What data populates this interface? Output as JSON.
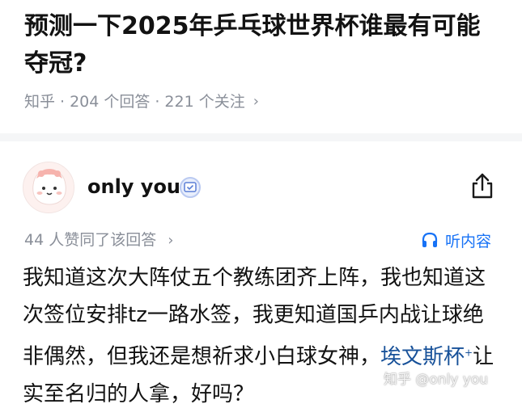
{
  "question": {
    "title": "预测一下2025年乒乓球世界杯谁最有可能夺冠?",
    "source": "知乎",
    "answers_count": "204 个回答",
    "follow_count": "221 个关注",
    "separator": "·",
    "chevron": "›"
  },
  "author": {
    "name": "only you",
    "verified_icon": "verified-badge-icon",
    "share_icon": "share-icon"
  },
  "answer": {
    "vote_text": "44 人赞同了该回答",
    "vote_chevron": "›",
    "listen_label": "听内容",
    "listen_icon": "headphones-icon",
    "body_before_link": "我知道这次大阵仗五个教练团齐上阵，我也知道这次签位安排tz一路水签，我更知道国乒内战让球绝非偶然，但我还是想祈求小白球女神，",
    "link_text": "埃文斯杯",
    "link_mark": "+",
    "body_after_link": "让实至名归的人拿，好吗？"
  },
  "watermark": "知乎 @only you",
  "colors": {
    "accent": "#1772f6",
    "link": "#175199",
    "meta": "#8a8f99",
    "title": "#121212"
  }
}
